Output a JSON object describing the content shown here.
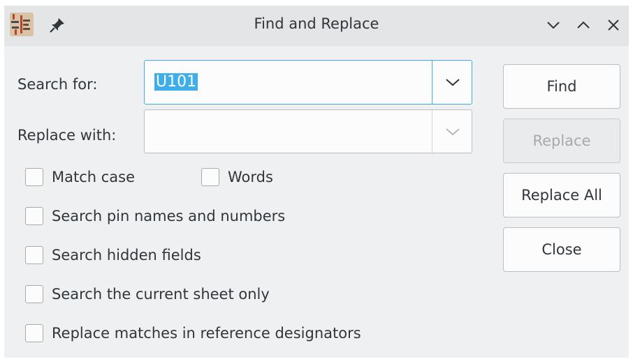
{
  "window": {
    "title": "Find and Replace",
    "icons": {
      "app": "kicad-schematic-icon",
      "pin": "pin-icon",
      "minimize": "chevron-down-icon",
      "maximize": "chevron-up-icon",
      "close": "close-icon"
    }
  },
  "form": {
    "search_label": "Search for:",
    "search_value": "U101",
    "replace_label": "Replace with:",
    "replace_value": ""
  },
  "options": {
    "match_case": {
      "label": "Match case",
      "checked": false
    },
    "words": {
      "label": "Words",
      "checked": false
    },
    "search_pins": {
      "label": "Search pin names and numbers",
      "checked": false
    },
    "search_hidden": {
      "label": "Search hidden fields",
      "checked": false
    },
    "current_sheet": {
      "label": "Search the current sheet only",
      "checked": false
    },
    "replace_refdes": {
      "label": "Replace matches in reference designators",
      "checked": false
    }
  },
  "buttons": {
    "find": "Find",
    "replace": "Replace",
    "replace_all": "Replace All",
    "close": "Close"
  },
  "colors": {
    "accent": "#3daee9",
    "window_bg": "#eff0f1",
    "titlebar_bg": "#e3e5e7",
    "text": "#31363b",
    "disabled_text": "#a7a9ab"
  }
}
